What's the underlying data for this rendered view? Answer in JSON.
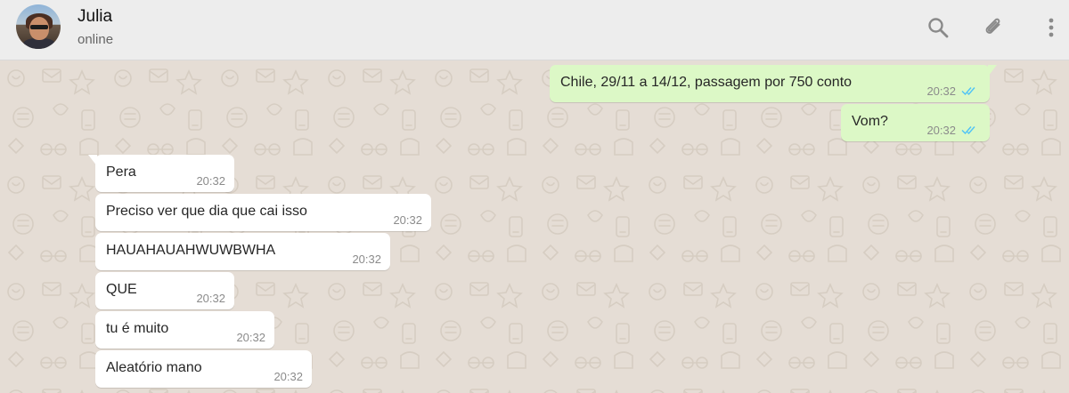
{
  "contact": {
    "name": "Julia",
    "status": "online"
  },
  "header_icons": [
    "search-icon",
    "paperclip-icon",
    "more-vertical-icon"
  ],
  "colors": {
    "header_bg": "#ededed",
    "chat_bg": "#e5ddd5",
    "outgoing_bubble": "#dcf8c6",
    "incoming_bubble": "#ffffff",
    "read_ticks": "#4fc3f7"
  },
  "messages": [
    {
      "direction": "out",
      "text": "Chile, 29/11 a 14/12, passagem por 750 conto",
      "time": "20:32",
      "status": "read"
    },
    {
      "direction": "out",
      "text": "Vom?",
      "time": "20:32",
      "status": "read"
    },
    {
      "direction": "in",
      "text": "Pera",
      "time": "20:32"
    },
    {
      "direction": "in",
      "text": "Preciso ver que dia que cai isso",
      "time": "20:32"
    },
    {
      "direction": "in",
      "text": "HAUAHAUAHWUWBWHA",
      "time": "20:32"
    },
    {
      "direction": "in",
      "text": "QUE",
      "time": "20:32"
    },
    {
      "direction": "in",
      "text": "tu é muito",
      "time": "20:32"
    },
    {
      "direction": "in",
      "text": "Aleatório mano",
      "time": "20:32"
    }
  ]
}
